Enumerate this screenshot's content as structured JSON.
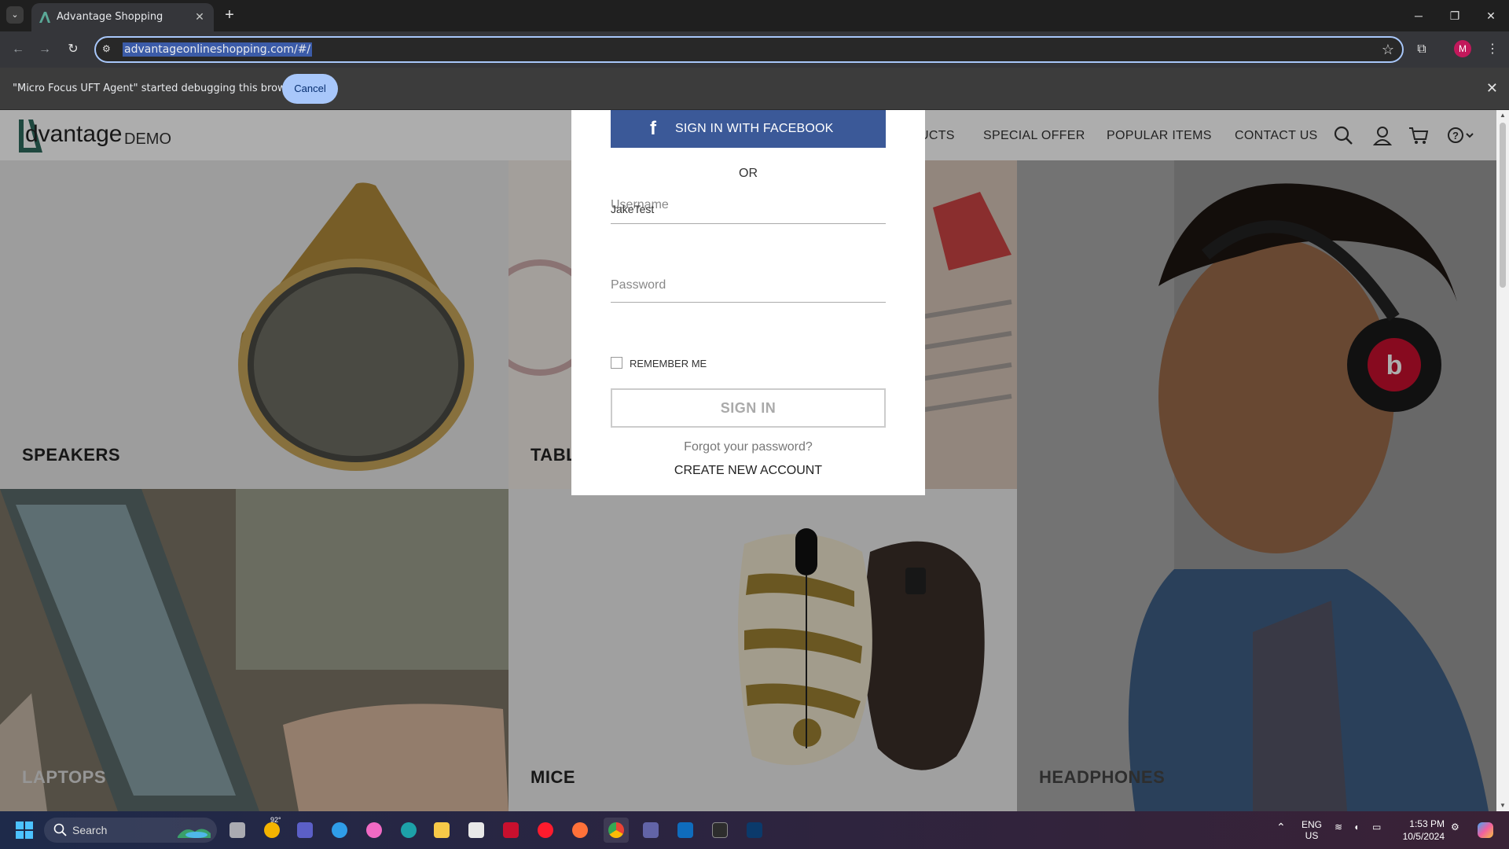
{
  "browser": {
    "tab_title": "Advantage Shopping",
    "url": "advantageonlineshopping.com/#/",
    "avatar_initial": "M",
    "infobar_message": "\"Micro Focus UFT Agent\" started debugging this browser",
    "infobar_cancel": "Cancel"
  },
  "site": {
    "logo_brand": "dvantage",
    "logo_demo": "DEMO",
    "nav": {
      "our_products_partial": "UCTS",
      "special_offer": "SPECIAL OFFER",
      "popular_items": "POPULAR ITEMS",
      "contact_us": "CONTACT US"
    },
    "categories": {
      "speakers": "SPEAKERS",
      "tablets_partial": "TABL",
      "laptops": "LAPTOPS",
      "mice": "MICE",
      "headphones": "HEADPHONES"
    }
  },
  "login": {
    "facebook_button": "SIGN IN WITH FACEBOOK",
    "or": "OR",
    "username_label": "Username",
    "username_value": "JakeTest",
    "password_label": "Password",
    "remember_me": "REMEMBER ME",
    "remember_checked": false,
    "sign_in_button": "SIGN IN",
    "forgot_password": "Forgot your password?",
    "create_account": "CREATE NEW ACCOUNT"
  },
  "taskbar": {
    "search_placeholder": "Search",
    "weather_temp": "92°",
    "language": "ENG",
    "region": "US",
    "time": "1:53 PM",
    "date": "10/5/2024"
  },
  "colors": {
    "facebook": "#3b5998",
    "brand_teal": "#2e6b5e",
    "chrome_accent": "#a8c7fa"
  }
}
